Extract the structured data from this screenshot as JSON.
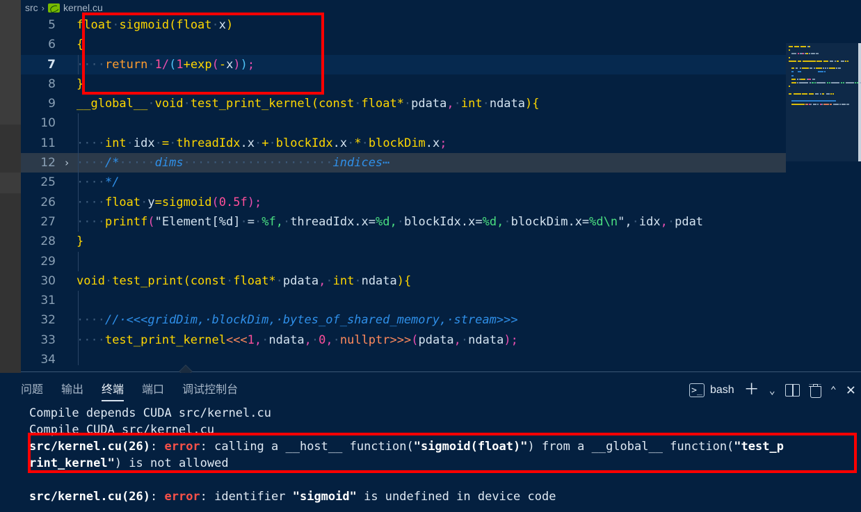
{
  "breadcrumb": {
    "folder": "src",
    "separator": "›",
    "file": "kernel.cu",
    "file_icon": "nvidia-cuda-icon"
  },
  "editor": {
    "language": "cuda-cpp",
    "lines": [
      {
        "num": "5",
        "fold": "",
        "state": "normal",
        "tokens": [
          {
            "t": "float",
            "c": "t-kw"
          },
          {
            "t": "·",
            "c": "ws"
          },
          {
            "t": "sigmoid",
            "c": "t-fn"
          },
          {
            "t": "(",
            "c": "t-paren"
          },
          {
            "t": "float",
            "c": "t-kw"
          },
          {
            "t": "·",
            "c": "ws"
          },
          {
            "t": "x",
            "c": "t-var"
          },
          {
            "t": ")",
            "c": "t-paren"
          }
        ]
      },
      {
        "num": "6",
        "fold": "",
        "state": "normal",
        "tokens": [
          {
            "t": "{",
            "c": "t-paren"
          }
        ]
      },
      {
        "num": "7",
        "fold": "",
        "state": "active",
        "tokens": [
          {
            "t": "····",
            "c": "ws"
          },
          {
            "t": "return",
            "c": "t-kw2"
          },
          {
            "t": "·",
            "c": "ws"
          },
          {
            "t": "1",
            "c": "t-num"
          },
          {
            "t": "/",
            "c": "t-punc"
          },
          {
            "t": "(",
            "c": "t-paren2"
          },
          {
            "t": "1",
            "c": "t-num"
          },
          {
            "t": "+",
            "c": "t-op"
          },
          {
            "t": "exp",
            "c": "t-fn"
          },
          {
            "t": "(",
            "c": "t-paren3"
          },
          {
            "t": "-",
            "c": "t-op"
          },
          {
            "t": "x",
            "c": "t-var"
          },
          {
            "t": ")",
            "c": "t-paren3"
          },
          {
            "t": ")",
            "c": "t-paren2"
          },
          {
            "t": ";",
            "c": "t-punc"
          }
        ]
      },
      {
        "num": "8",
        "fold": "",
        "state": "normal",
        "tokens": [
          {
            "t": "}",
            "c": "t-paren"
          }
        ]
      },
      {
        "num": "9",
        "fold": "",
        "state": "normal",
        "tokens": [
          {
            "t": "__global__",
            "c": "t-kw"
          },
          {
            "t": "·",
            "c": "ws"
          },
          {
            "t": "void",
            "c": "t-kw"
          },
          {
            "t": "·",
            "c": "ws"
          },
          {
            "t": "test_print_kernel",
            "c": "t-fn"
          },
          {
            "t": "(",
            "c": "t-paren"
          },
          {
            "t": "const",
            "c": "t-kw"
          },
          {
            "t": "·",
            "c": "ws"
          },
          {
            "t": "float*",
            "c": "t-kw"
          },
          {
            "t": "·",
            "c": "ws"
          },
          {
            "t": "pdata",
            "c": "t-var"
          },
          {
            "t": ",",
            "c": "t-punc"
          },
          {
            "t": "·",
            "c": "ws"
          },
          {
            "t": "int",
            "c": "t-kw"
          },
          {
            "t": "·",
            "c": "ws"
          },
          {
            "t": "ndata",
            "c": "t-var"
          },
          {
            "t": ")",
            "c": "t-paren"
          },
          {
            "t": "{",
            "c": "t-paren"
          }
        ]
      },
      {
        "num": "10",
        "fold": "",
        "state": "normal",
        "tokens": []
      },
      {
        "num": "11",
        "fold": "",
        "state": "normal",
        "tokens": [
          {
            "t": "····",
            "c": "ws"
          },
          {
            "t": "int",
            "c": "t-kw"
          },
          {
            "t": "·",
            "c": "ws"
          },
          {
            "t": "idx",
            "c": "t-var"
          },
          {
            "t": "·",
            "c": "ws"
          },
          {
            "t": "=",
            "c": "t-op"
          },
          {
            "t": "·",
            "c": "ws"
          },
          {
            "t": "threadIdx",
            "c": "t-fn"
          },
          {
            "t": ".",
            "c": "t-var"
          },
          {
            "t": "x",
            "c": "t-var"
          },
          {
            "t": "·",
            "c": "ws"
          },
          {
            "t": "+",
            "c": "t-op"
          },
          {
            "t": "·",
            "c": "ws"
          },
          {
            "t": "blockIdx",
            "c": "t-fn"
          },
          {
            "t": ".",
            "c": "t-var"
          },
          {
            "t": "x",
            "c": "t-var"
          },
          {
            "t": "·",
            "c": "ws"
          },
          {
            "t": "*",
            "c": "t-op"
          },
          {
            "t": "·",
            "c": "ws"
          },
          {
            "t": "blockDim",
            "c": "t-fn"
          },
          {
            "t": ".",
            "c": "t-var"
          },
          {
            "t": "x",
            "c": "t-var"
          },
          {
            "t": ";",
            "c": "t-punc"
          }
        ]
      },
      {
        "num": "12",
        "fold": "›",
        "state": "hovered",
        "tokens": [
          {
            "t": "····",
            "c": "ws"
          },
          {
            "t": "/*",
            "c": "t-cmt"
          },
          {
            "t": "·····",
            "c": "ws"
          },
          {
            "t": "dims",
            "c": "t-cmt"
          },
          {
            "t": "·····················",
            "c": "ws"
          },
          {
            "t": "indices",
            "c": "t-cmt"
          },
          {
            "t": "⋯",
            "c": "t-cmt"
          }
        ]
      },
      {
        "num": "25",
        "fold": "",
        "state": "normal",
        "tokens": [
          {
            "t": "····",
            "c": "ws"
          },
          {
            "t": "*/",
            "c": "t-cmt"
          }
        ]
      },
      {
        "num": "26",
        "fold": "",
        "state": "normal",
        "tokens": [
          {
            "t": "····",
            "c": "ws"
          },
          {
            "t": "float",
            "c": "t-kw"
          },
          {
            "t": "·",
            "c": "ws"
          },
          {
            "t": "y",
            "c": "t-var"
          },
          {
            "t": "=",
            "c": "t-op"
          },
          {
            "t": "sigmoid",
            "c": "t-fn"
          },
          {
            "t": "(",
            "c": "t-paren3"
          },
          {
            "t": "0.5f",
            "c": "t-num"
          },
          {
            "t": ")",
            "c": "t-paren3"
          },
          {
            "t": ";",
            "c": "t-punc"
          }
        ]
      },
      {
        "num": "27",
        "fold": "",
        "state": "normal",
        "tokens": [
          {
            "t": "····",
            "c": "ws"
          },
          {
            "t": "printf",
            "c": "t-fn"
          },
          {
            "t": "(",
            "c": "t-paren3"
          },
          {
            "t": "\"Element[%d]",
            "c": "t-str"
          },
          {
            "t": "·",
            "c": "ws"
          },
          {
            "t": "=",
            "c": "t-str"
          },
          {
            "t": "·",
            "c": "ws"
          },
          {
            "t": "%f",
            "c": "t-fmt"
          },
          {
            "t": ",",
            "c": "t-fmt"
          },
          {
            "t": "·",
            "c": "ws"
          },
          {
            "t": "threadIdx.x=",
            "c": "t-str"
          },
          {
            "t": "%d",
            "c": "t-fmt"
          },
          {
            "t": ",",
            "c": "t-fmt"
          },
          {
            "t": "·",
            "c": "ws"
          },
          {
            "t": "blockIdx.x=",
            "c": "t-str"
          },
          {
            "t": "%d",
            "c": "t-fmt"
          },
          {
            "t": ",",
            "c": "t-fmt"
          },
          {
            "t": "·",
            "c": "ws"
          },
          {
            "t": "blockDim.x=",
            "c": "t-str"
          },
          {
            "t": "%d",
            "c": "t-fmt"
          },
          {
            "t": "\\n",
            "c": "t-fmt"
          },
          {
            "t": "\",",
            "c": "t-str"
          },
          {
            "t": "·",
            "c": "ws"
          },
          {
            "t": "idx",
            "c": "t-var"
          },
          {
            "t": ",",
            "c": "t-punc"
          },
          {
            "t": "·",
            "c": "ws"
          },
          {
            "t": "pdat",
            "c": "t-var"
          }
        ]
      },
      {
        "num": "28",
        "fold": "",
        "state": "normal",
        "tokens": [
          {
            "t": "}",
            "c": "t-paren"
          }
        ]
      },
      {
        "num": "29",
        "fold": "",
        "state": "normal",
        "tokens": []
      },
      {
        "num": "30",
        "fold": "",
        "state": "normal",
        "tokens": [
          {
            "t": "void",
            "c": "t-kw"
          },
          {
            "t": "·",
            "c": "ws"
          },
          {
            "t": "test_print",
            "c": "t-fn"
          },
          {
            "t": "(",
            "c": "t-paren"
          },
          {
            "t": "const",
            "c": "t-kw"
          },
          {
            "t": "·",
            "c": "ws"
          },
          {
            "t": "float*",
            "c": "t-kw"
          },
          {
            "t": "·",
            "c": "ws"
          },
          {
            "t": "pdata",
            "c": "t-var"
          },
          {
            "t": ",",
            "c": "t-punc"
          },
          {
            "t": "·",
            "c": "ws"
          },
          {
            "t": "int",
            "c": "t-kw"
          },
          {
            "t": "·",
            "c": "ws"
          },
          {
            "t": "ndata",
            "c": "t-var"
          },
          {
            "t": ")",
            "c": "t-paren"
          },
          {
            "t": "{",
            "c": "t-paren"
          }
        ]
      },
      {
        "num": "31",
        "fold": "",
        "state": "normal",
        "tokens": []
      },
      {
        "num": "32",
        "fold": "",
        "state": "normal",
        "tokens": [
          {
            "t": "····",
            "c": "ws"
          },
          {
            "t": "//·<<<gridDim,·blockDim,·bytes_of_shared_memory,·stream>>>",
            "c": "t-cmt"
          }
        ]
      },
      {
        "num": "33",
        "fold": "",
        "state": "normal",
        "tokens": [
          {
            "t": "····",
            "c": "ws"
          },
          {
            "t": "test_print_kernel",
            "c": "t-fn"
          },
          {
            "t": "<<<",
            "c": "t-tri"
          },
          {
            "t": "1",
            "c": "t-num"
          },
          {
            "t": ",",
            "c": "t-punc"
          },
          {
            "t": "·",
            "c": "ws"
          },
          {
            "t": "ndata",
            "c": "t-var"
          },
          {
            "t": ",",
            "c": "t-punc"
          },
          {
            "t": "·",
            "c": "ws"
          },
          {
            "t": "0",
            "c": "t-num"
          },
          {
            "t": ",",
            "c": "t-punc"
          },
          {
            "t": "·",
            "c": "ws"
          },
          {
            "t": "nullptr",
            "c": "t-null"
          },
          {
            "t": ">>>",
            "c": "t-tri"
          },
          {
            "t": "(",
            "c": "t-paren3"
          },
          {
            "t": "pdata",
            "c": "t-var"
          },
          {
            "t": ",",
            "c": "t-punc"
          },
          {
            "t": "·",
            "c": "ws"
          },
          {
            "t": "ndata",
            "c": "t-var"
          },
          {
            "t": ")",
            "c": "t-paren3"
          },
          {
            "t": ";",
            "c": "t-punc"
          }
        ]
      },
      {
        "num": "34",
        "fold": "",
        "state": "normal",
        "tokens": []
      }
    ]
  },
  "panel": {
    "tabs": [
      {
        "label": "问题",
        "active": false
      },
      {
        "label": "输出",
        "active": false
      },
      {
        "label": "终端",
        "active": true
      },
      {
        "label": "端口",
        "active": false
      },
      {
        "label": "调试控制台",
        "active": false
      }
    ],
    "actions": {
      "shell_icon": "terminal-chevron-icon",
      "shell_label": "bash",
      "new_terminal_icon": "plus-icon",
      "dropdown_icon": "chevron-down-icon",
      "split_icon": "split-terminal-icon",
      "kill_icon": "trash-icon",
      "maximize_icon": "chevron-up-icon",
      "close_icon": "close-x-icon"
    },
    "terminal_lines": [
      {
        "segments": [
          {
            "t": "Compile depends CUDA src/kernel.cu",
            "c": ""
          }
        ]
      },
      {
        "segments": [
          {
            "t": "Compile CUDA src/kernel.cu",
            "c": ""
          }
        ]
      },
      {
        "segments": [
          {
            "t": "src/kernel.cu(26)",
            "c": "t-bold"
          },
          {
            "t": ": ",
            "c": ""
          },
          {
            "t": "error",
            "c": "t-err"
          },
          {
            "t": ": calling a __host__ function(",
            "c": ""
          },
          {
            "t": "\"sigmoid(float)\"",
            "c": "t-bold"
          },
          {
            "t": ") from a __global__ function(",
            "c": ""
          },
          {
            "t": "\"test_p",
            "c": "t-bold"
          }
        ]
      },
      {
        "segments": [
          {
            "t": "rint_kernel\"",
            "c": "t-bold"
          },
          {
            "t": ") is not allowed",
            "c": ""
          }
        ]
      },
      {
        "segments": []
      },
      {
        "segments": [
          {
            "t": "src/kernel.cu(26)",
            "c": "t-bold"
          },
          {
            "t": ": ",
            "c": ""
          },
          {
            "t": "error",
            "c": "t-err"
          },
          {
            "t": ": identifier ",
            "c": ""
          },
          {
            "t": "\"sigmoid\"",
            "c": "t-bold"
          },
          {
            "t": " is undefined in device code",
            "c": ""
          }
        ]
      }
    ]
  },
  "annotations": {
    "code_highlight_color": "#ff0000",
    "terminal_highlight_color": "#ff0000"
  },
  "theme": {
    "editor_background": "#042040",
    "panel_background": "#042040",
    "sidebar_background": "#333333",
    "accent": "#76b900"
  }
}
